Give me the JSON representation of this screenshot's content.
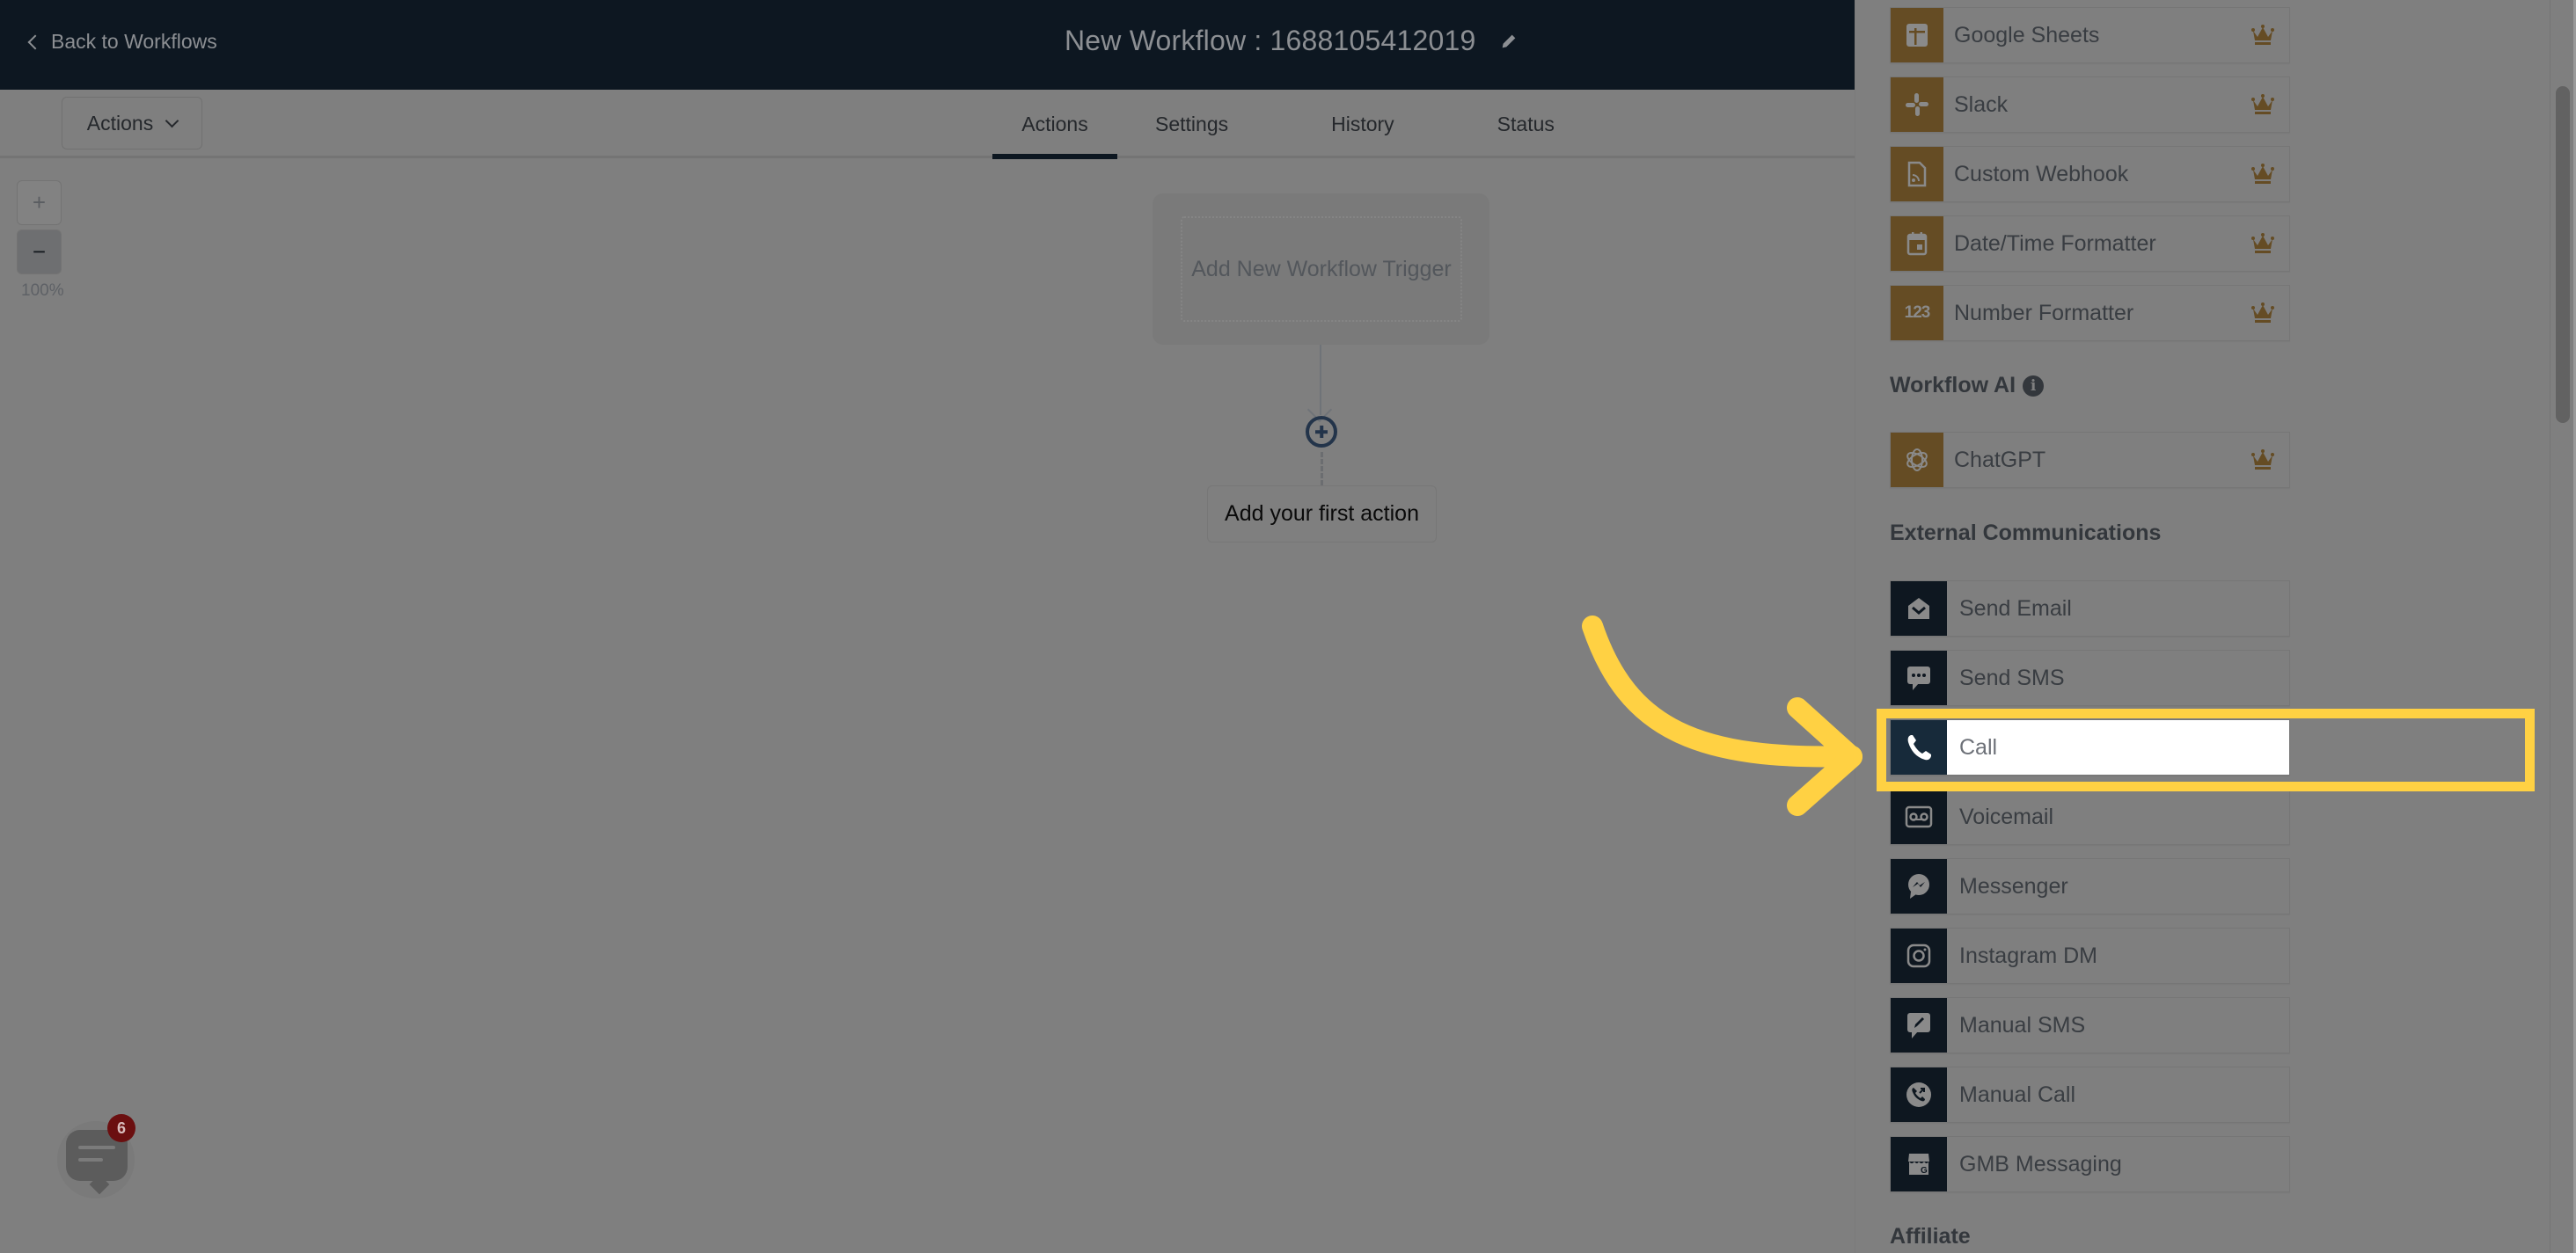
{
  "header": {
    "back_label": "Back to Workflows",
    "title": "New Workflow : 1688105412019"
  },
  "subnav": {
    "actions_dropdown": "Actions",
    "tabs": [
      {
        "label": "Actions",
        "active": true
      },
      {
        "label": "Settings",
        "active": false
      },
      {
        "label": "History",
        "active": false
      },
      {
        "label": "Status",
        "active": false
      }
    ]
  },
  "canvas": {
    "zoom_in": "+",
    "zoom_out": "−",
    "zoom_level": "100%",
    "trigger_label": "Add New Workflow Trigger",
    "first_action_label": "Add your first action"
  },
  "chat": {
    "badge_count": "6"
  },
  "panel": {
    "premium_items": [
      {
        "label": "Google Sheets",
        "icon": "google-sheets-icon",
        "premium": true
      },
      {
        "label": "Slack",
        "icon": "slack-icon",
        "premium": true
      },
      {
        "label": "Custom Webhook",
        "icon": "webhook-icon",
        "premium": true
      },
      {
        "label": "Date/Time Formatter",
        "icon": "calendar-icon",
        "premium": true
      },
      {
        "label": "Number Formatter",
        "icon": "number-icon",
        "premium": true
      }
    ],
    "sections": [
      {
        "title": "Workflow AI",
        "has_info": true
      },
      {
        "title": "External Communications",
        "has_info": false
      },
      {
        "title": "Affiliate",
        "has_info": false
      }
    ],
    "ai_items": [
      {
        "label": "ChatGPT",
        "icon": "openai-icon",
        "premium": true
      }
    ],
    "comm_items": [
      {
        "label": "Send Email",
        "icon": "email-icon"
      },
      {
        "label": "Send SMS",
        "icon": "sms-icon"
      },
      {
        "label": "Call",
        "icon": "phone-icon",
        "highlighted": true
      },
      {
        "label": "Voicemail",
        "icon": "voicemail-icon"
      },
      {
        "label": "Messenger",
        "icon": "messenger-icon"
      },
      {
        "label": "Instagram DM",
        "icon": "instagram-icon"
      },
      {
        "label": "Manual SMS",
        "icon": "manual-sms-icon"
      },
      {
        "label": "Manual Call",
        "icon": "manual-call-icon"
      },
      {
        "label": "GMB Messaging",
        "icon": "gmb-icon"
      }
    ]
  },
  "colors": {
    "header_bg": "#0d1721",
    "premium_icon_bg": "#654c24",
    "comm_icon_bg": "#0e1720",
    "highlight": "#ffd143",
    "crown": "#654c24"
  }
}
